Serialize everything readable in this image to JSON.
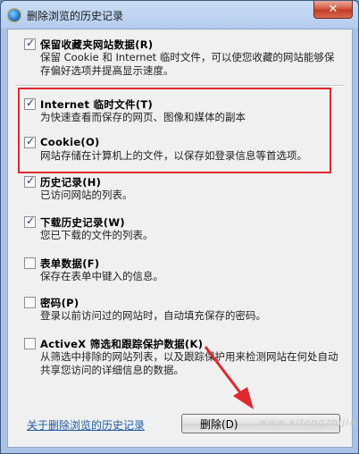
{
  "window": {
    "title": "删除浏览的历史记录",
    "close_symbol": "✕"
  },
  "items": [
    {
      "label": "保留收藏夹网站数据(R)",
      "desc": "保留 Cookie 和 Internet 临时文件，可以使您收藏的网站能够保存偏好选项并提高显示速度。",
      "checked": true
    },
    {
      "label": "Internet 临时文件(T)",
      "desc": "为快速查看而保存的网页、图像和媒体的副本",
      "checked": true
    },
    {
      "label": "Cookie(O)",
      "desc": "网站存储在计算机上的文件，以保存如登录信息等首选项。",
      "checked": true
    },
    {
      "label": "历史记录(H)",
      "desc": "已访问网站的列表。",
      "checked": true
    },
    {
      "label": "下载历史记录(W)",
      "desc": "您已下载的文件的列表。",
      "checked": true
    },
    {
      "label": "表单数据(F)",
      "desc": "保存在表单中键入的信息。",
      "checked": false
    },
    {
      "label": "密码(P)",
      "desc": "登录以前访问过的网站时，自动填充保存的密码。",
      "checked": false
    },
    {
      "label": "ActiveX 筛选和跟踪保护数据(K)",
      "desc": "从筛选中排除的网站列表，以及跟踪保护用来检测网站在何处自动共享您访问的详细信息的数据。",
      "checked": false
    }
  ],
  "footer": {
    "link": "关于删除浏览的历史记录",
    "delete_button": "删除(D)",
    "watermark": "www.xitongzhijia.net"
  },
  "colors": {
    "highlight": "#e0282e",
    "arrow": "#e0282e",
    "link": "#1e5aa6"
  }
}
